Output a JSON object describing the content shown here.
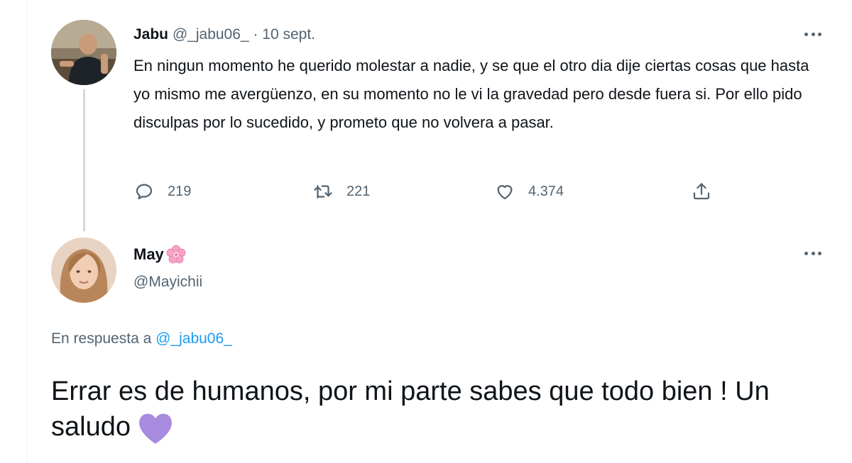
{
  "parent_tweet": {
    "name": "Jabu",
    "handle": "@_jabu06_",
    "separator": "·",
    "date": "10 sept.",
    "text": "En ningun momento he querido molestar a nadie, y se que el otro dia dije ciertas cosas que hasta yo mismo me avergüenzo, en su momento no le vi la gravedad pero desde fuera si. Por ello pido disculpas por lo sucedido, y prometo que no volvera a pasar.",
    "replies": "219",
    "retweets": "221",
    "likes": "4.374",
    "icons": [
      "reply-icon",
      "retweet-icon",
      "like-icon",
      "share-icon",
      "more-icon"
    ]
  },
  "reply_tweet": {
    "name": "May",
    "name_emoji": "cherry-blossom-icon",
    "handle": "@Mayichii",
    "reply_prefix": "En respuesta a",
    "reply_to": "@_jabu06_",
    "text": "Errar es de humanos, por mi parte sabes que todo bien ! Un saludo",
    "trailing_emoji": "purple-heart-icon"
  },
  "colors": {
    "text_primary": "#0f1419",
    "text_secondary": "#536471",
    "link": "#1d9bf0",
    "thread_line": "#cfd9de",
    "purple_heart": "#a78bde",
    "blossom": "#f6a3c4"
  }
}
